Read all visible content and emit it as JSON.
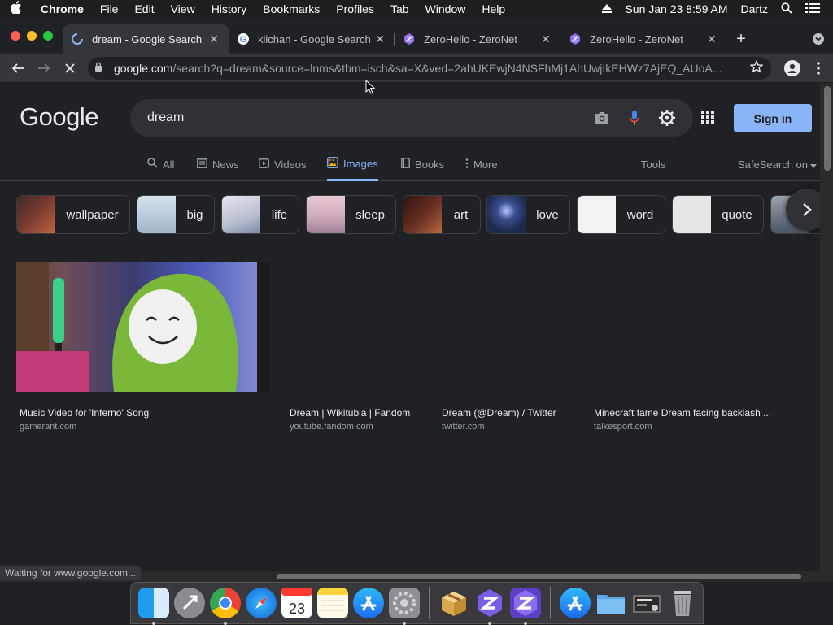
{
  "menubar": {
    "app": "Chrome",
    "items": [
      "File",
      "Edit",
      "View",
      "History",
      "Bookmarks",
      "Profiles",
      "Tab",
      "Window",
      "Help"
    ],
    "clock": "Sun Jan 23  8:59 AM",
    "user": "Dartz"
  },
  "tabs": [
    {
      "title": "dream - Google Search",
      "icon": "loading-spinner-icon",
      "active": true
    },
    {
      "title": "kiichan - Google Search",
      "icon": "google-g-icon",
      "active": false
    },
    {
      "title": "ZeroHello - ZeroNet",
      "icon": "zeronet-icon",
      "active": false
    },
    {
      "title": "ZeroHello - ZeroNet",
      "icon": "zeronet-icon",
      "active": false
    }
  ],
  "address": {
    "host": "google.com",
    "path": "/search?q=dream&source=lnms&tbm=isch&sa=X&ved=2ahUKEwjN4NSFhMj1AhUwjIkEHWz7AjEQ_AUoA..."
  },
  "google": {
    "logo": "Google",
    "query": "dream",
    "signin": "Sign in"
  },
  "nav": {
    "all": "All",
    "news": "News",
    "videos": "Videos",
    "images": "Images",
    "books": "Books",
    "more": "More",
    "tools": "Tools",
    "safesearch": "SafeSearch on"
  },
  "chips": [
    {
      "label": "wallpaper",
      "color": "#7a3b2e"
    },
    {
      "label": "big",
      "color": "#9fb7c9"
    },
    {
      "label": "life",
      "color": "#b9bfd0"
    },
    {
      "label": "sleep",
      "color": "#c9a9b8"
    },
    {
      "label": "art",
      "color": "#6b2f24"
    },
    {
      "label": "love",
      "color": "#1c2a4d"
    },
    {
      "label": "word",
      "color": "#f2f2f2"
    },
    {
      "label": "quote",
      "color": "#e6e6e6"
    }
  ],
  "results": [
    {
      "title": "Music Video for 'Inferno' Song",
      "source": "gamerant.com"
    },
    {
      "title": "Dream | Wikitubia | Fandom",
      "source": "youtube.fandom.com"
    },
    {
      "title": "Dream (@Dream) / Twitter",
      "source": "twitter.com"
    },
    {
      "title": "Minecraft fame Dream facing backlash ...",
      "source": "talkesport.com"
    }
  ],
  "status": "Waiting for www.google.com...",
  "colors": {
    "accent": "#8ab4f8",
    "background": "#202124",
    "search_box": "#303134"
  }
}
